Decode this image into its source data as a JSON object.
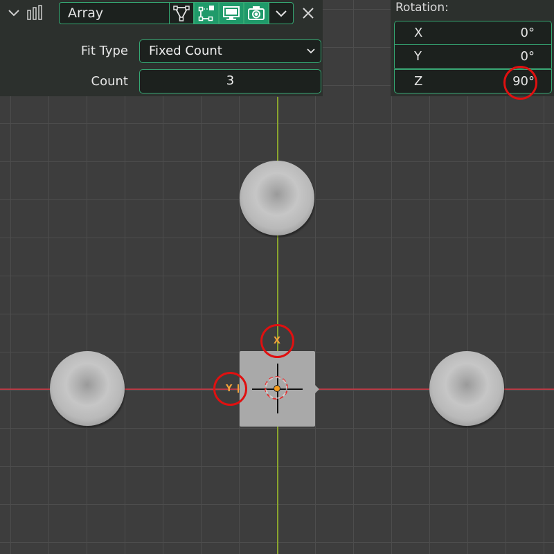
{
  "modifier": {
    "name": "Array",
    "fit_type_label": "Fit Type",
    "fit_type_value": "Fixed Count",
    "count_label": "Count",
    "count_value": "3",
    "buttons": [
      {
        "icon": "edit-mode-icon",
        "state": "off"
      },
      {
        "icon": "cage-icon",
        "state": "on"
      },
      {
        "icon": "monitor-icon",
        "state": "on"
      },
      {
        "icon": "camera-icon",
        "state": "on"
      }
    ]
  },
  "rotation": {
    "title": "Rotation:",
    "rows": [
      {
        "axis": "X",
        "value": "0°"
      },
      {
        "axis": "Y",
        "value": "0°"
      },
      {
        "axis": "Z",
        "value": "90°"
      }
    ]
  },
  "viewport": {
    "gizmo_x_label": "X",
    "gizmo_y_label": "Y"
  },
  "colors": {
    "accent": "#35a873",
    "x_axis": "#b83a44",
    "y_axis": "#8aa52d",
    "origin": "#f39a1c",
    "highlight": "#e01010"
  }
}
